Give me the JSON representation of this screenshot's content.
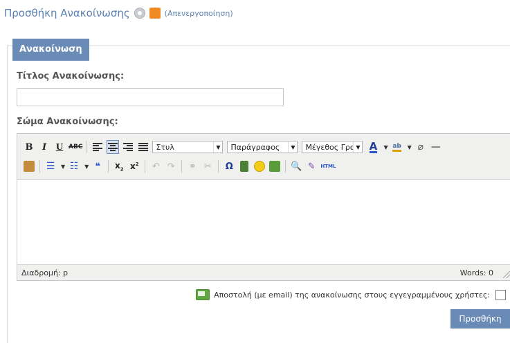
{
  "header": {
    "title": "Προσθήκη Ανακοίνωσης",
    "rss_toggle_label": "(Απενεργοποίηση)",
    "icons": [
      "help-icon",
      "rss-icon"
    ]
  },
  "form": {
    "tab_label": "Ανακοίνωση",
    "title_label": "Τίτλος Ανακοίνωσης:",
    "title_value": "",
    "body_label": "Σώμα Ανακοίνωσης:"
  },
  "editor": {
    "toolbar_row1": [
      "B",
      "I",
      "U",
      "ABC"
    ],
    "style_select": "Στυλ",
    "format_select": "Παράγραφος",
    "size_select": "Μέγεθος Γραμμ",
    "html_label": "HTML",
    "omega_symbol": "Ω",
    "quote_symbol": "❝",
    "status_path": "Διαδρομή: p",
    "status_words": "Words: 0",
    "content": ""
  },
  "footer": {
    "notify_label": "Αποστολή (με email) της ανακοίνωσης στους εγγεγραμμένους χρήστες:",
    "notify_checked": false,
    "submit_label": "Προσθήκη"
  },
  "colors": {
    "accent": "#6b8bb7",
    "link": "#5a7fb0",
    "rss": "#f08a24"
  }
}
